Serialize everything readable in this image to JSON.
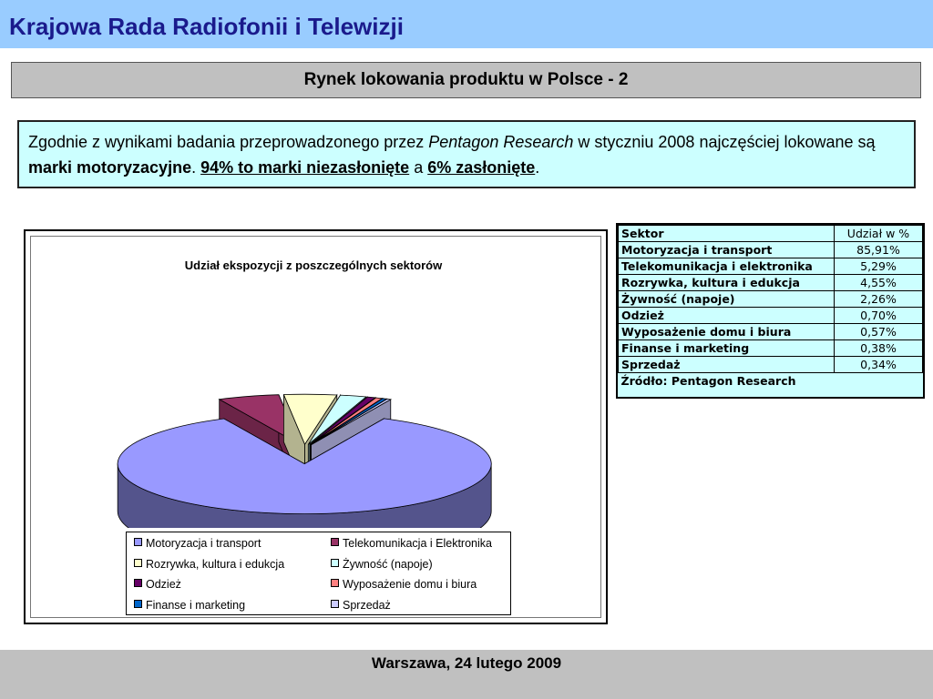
{
  "header": {
    "title": "Krajowa Rada Radiofonii i Telewizji"
  },
  "subtitle": "Rynek lokowania produktu w Polsce - 2",
  "info": {
    "part1": "Zgodnie z wynikami badania przeprowadzonego przez ",
    "source_italic": "Pentagon Research",
    "part2": " w styczniu 2008 najczęściej lokowane są ",
    "bold1": "marki motoryzacyjne",
    "part3": ". ",
    "underlined1": "94% to marki niezasłonięte",
    "part4": " a ",
    "underlined2": "6% zasłonięte",
    "part5": "."
  },
  "chart_data": {
    "type": "pie",
    "title": "Udział ekspozycji z poszczególnych sektorów",
    "style": "3d-exploded",
    "legend_position": "bottom",
    "series": [
      {
        "name": "Motoryzacja i transport",
        "value": 85.91,
        "color": "#9999ff"
      },
      {
        "name": "Telekomunikacja i Elektronika",
        "value": 5.29,
        "color": "#993366"
      },
      {
        "name": "Rozrywka, kultura i edukcja",
        "value": 4.55,
        "color": "#ffffcc"
      },
      {
        "name": "Żywność (napoje)",
        "value": 2.26,
        "color": "#ccffff"
      },
      {
        "name": "Odzież",
        "value": 0.7,
        "color": "#660066"
      },
      {
        "name": "Wyposażenie domu i biura",
        "value": 0.57,
        "color": "#ff8080"
      },
      {
        "name": "Finanse i marketing",
        "value": 0.38,
        "color": "#0066cc"
      },
      {
        "name": "Sprzedaż",
        "value": 0.34,
        "color": "#ccccff"
      }
    ]
  },
  "table": {
    "headers": [
      "Sektor",
      "Udział w %"
    ],
    "rows": [
      [
        "Motoryzacja i transport",
        "85,91%"
      ],
      [
        "Telekomunikacja i elektronika",
        "5,29%"
      ],
      [
        "Rozrywka, kultura i edukcja",
        "4,55%"
      ],
      [
        "Żywność (napoje)",
        "2,26%"
      ],
      [
        "Odzież",
        "0,70%"
      ],
      [
        "Wyposażenie domu i biura",
        "0,57%"
      ],
      [
        "Finanse i marketing",
        "0,38%"
      ],
      [
        "Sprzedaż",
        "0,34%"
      ]
    ],
    "source": "Źródło: Pentagon Research"
  },
  "footer": {
    "text": "Warszawa, 24 lutego 2009"
  }
}
